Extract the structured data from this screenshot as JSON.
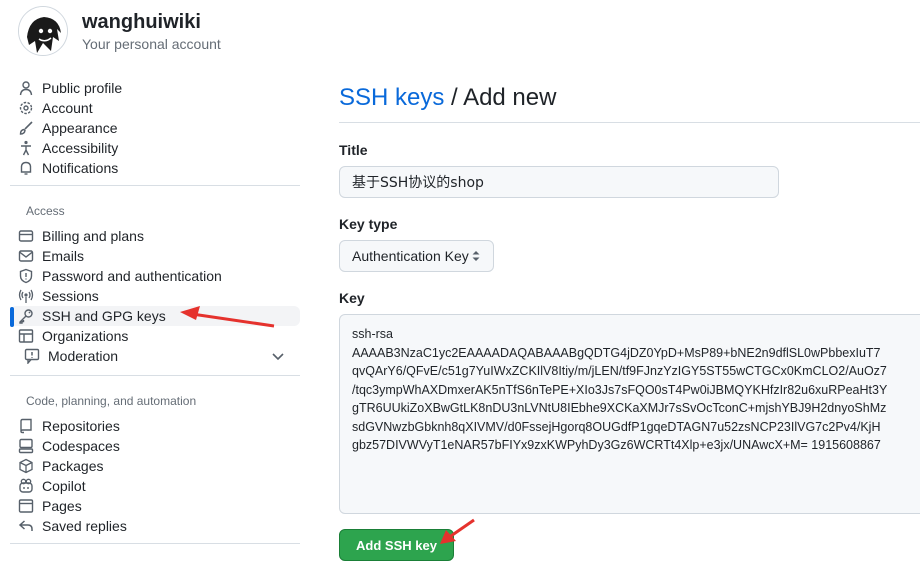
{
  "profile": {
    "username": "wanghuiwiki",
    "subtitle": "Your personal account",
    "avatar_icon": "avatar-image"
  },
  "sidebar": {
    "group1": [
      {
        "label": "Public profile",
        "icon": "person-icon"
      },
      {
        "label": "Account",
        "icon": "gear-icon"
      },
      {
        "label": "Appearance",
        "icon": "paintbrush-icon"
      },
      {
        "label": "Accessibility",
        "icon": "accessibility-icon"
      },
      {
        "label": "Notifications",
        "icon": "bell-icon"
      }
    ],
    "access_heading": "Access",
    "group2": [
      {
        "label": "Billing and plans",
        "icon": "credit-card-icon"
      },
      {
        "label": "Emails",
        "icon": "mail-icon"
      },
      {
        "label": "Password and authentication",
        "icon": "shield-icon"
      },
      {
        "label": "Sessions",
        "icon": "broadcast-icon"
      },
      {
        "label": "SSH and GPG keys",
        "icon": "key-icon",
        "selected": true
      },
      {
        "label": "Organizations",
        "icon": "table-icon"
      },
      {
        "label": "Moderation",
        "icon": "report-icon",
        "expandable": true
      }
    ],
    "code_heading": "Code, planning, and automation",
    "group3": [
      {
        "label": "Repositories",
        "icon": "repo-icon"
      },
      {
        "label": "Codespaces",
        "icon": "codespaces-icon"
      },
      {
        "label": "Packages",
        "icon": "package-icon"
      },
      {
        "label": "Copilot",
        "icon": "copilot-icon"
      },
      {
        "label": "Pages",
        "icon": "browser-icon"
      },
      {
        "label": "Saved replies",
        "icon": "reply-icon"
      }
    ]
  },
  "main": {
    "breadcrumb_link": "SSH keys",
    "breadcrumb_sep": " / ",
    "breadcrumb_current": "Add new",
    "title_label": "Title",
    "title_value": "基于SSH协议的shop",
    "key_type_label": "Key type",
    "key_type_value": "Authentication Key",
    "key_label": "Key",
    "key_value": "ssh-rsa\nAAAAB3NzaC1yc2EAAAADAQABAAABgQDTG4jDZ0YpD+MsP89+bNE2n9dflSL0wPbbexIuT7\nqvQArY6/QFvE/c51g7YuIWxZCKIlV8Itiy/m/jLEN/tf9FJnzYzIGY5ST55wCTGCx0KmCLO2/AuOz7\n/tqc3ympWhAXDmxerAK5nTfS6nTePE+XIo3Js7sFQO0sT4Pw0iJBMQYKHfzIr82u6xuRPeaHt3Y\ngTR6UUkiZoXBwGtLK8nDU3nLVNtU8IEbhe9XCKaXMJr7sSvOcTconC+mjshYBJ9H2dnyoShMz\nsdGVNwzbGbknh8qXIVMV/d0FssejHgorq8OUGdfP1gqeDTAGN7u52zsNCP23IlVG7c2Pv4/KjH\ngbz57DIVWVyT1eNAR57bFIYx9zxKWPyhDy3Gz6WCRTt4Xlp+e3jx/UNAwcX+M= 1915608867",
    "submit_label": "Add SSH key"
  },
  "colors": {
    "accent": "#0969da",
    "primary_button": "#2da44e",
    "annotation_arrow": "#e5322d"
  }
}
